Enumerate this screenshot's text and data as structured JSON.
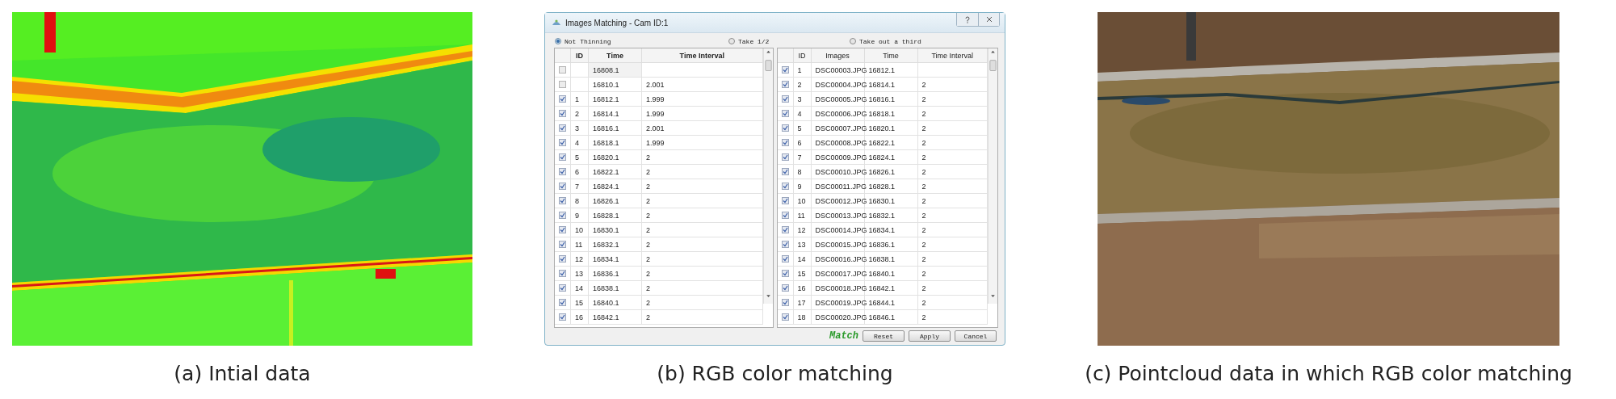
{
  "panels": [
    {
      "kind": "heatmap",
      "caption": "(a) Intial data"
    },
    {
      "kind": "dialog",
      "caption": "(b) RGB color matching"
    },
    {
      "kind": "aerial",
      "caption": "(c) Pointcloud data in which RGB color matching"
    }
  ],
  "dialog": {
    "title": "Images Matching - Cam ID:1",
    "options": [
      {
        "label": "Not Thinning",
        "selected": true
      },
      {
        "label": "Take 1/2",
        "selected": false
      },
      {
        "label": "Take out a third",
        "selected": false
      }
    ],
    "left_table": {
      "columns": [
        "ID",
        "Time",
        "Time Interval"
      ],
      "rows": [
        {
          "checked": false,
          "time": "16808.1"
        },
        {
          "checked": false,
          "time": "16810.1",
          "interval": "2.001"
        },
        {
          "checked": true,
          "id": "1",
          "time": "16812.1",
          "interval": "1.999"
        },
        {
          "checked": true,
          "id": "2",
          "time": "16814.1",
          "interval": "1.999"
        },
        {
          "checked": true,
          "id": "3",
          "time": "16816.1",
          "interval": "2.001"
        },
        {
          "checked": true,
          "id": "4",
          "time": "16818.1",
          "interval": "1.999"
        },
        {
          "checked": true,
          "id": "5",
          "time": "16820.1",
          "interval": "2"
        },
        {
          "checked": true,
          "id": "6",
          "time": "16822.1",
          "interval": "2"
        },
        {
          "checked": true,
          "id": "7",
          "time": "16824.1",
          "interval": "2"
        },
        {
          "checked": true,
          "id": "8",
          "time": "16826.1",
          "interval": "2"
        },
        {
          "checked": true,
          "id": "9",
          "time": "16828.1",
          "interval": "2"
        },
        {
          "checked": true,
          "id": "10",
          "time": "16830.1",
          "interval": "2"
        },
        {
          "checked": true,
          "id": "11",
          "time": "16832.1",
          "interval": "2"
        },
        {
          "checked": true,
          "id": "12",
          "time": "16834.1",
          "interval": "2"
        },
        {
          "checked": true,
          "id": "13",
          "time": "16836.1",
          "interval": "2"
        },
        {
          "checked": true,
          "id": "14",
          "time": "16838.1",
          "interval": "2"
        },
        {
          "checked": true,
          "id": "15",
          "time": "16840.1",
          "interval": "2"
        },
        {
          "checked": true,
          "id": "16",
          "time": "16842.1",
          "interval": "2"
        }
      ]
    },
    "right_table": {
      "columns": [
        "ID",
        "Images",
        "Time",
        "Time Interval"
      ],
      "rows": [
        {
          "checked": true,
          "id": "1",
          "image": "DSC00003.JPG",
          "time": "16812.1"
        },
        {
          "checked": true,
          "id": "2",
          "image": "DSC00004.JPG",
          "time": "16814.1",
          "interval": "2"
        },
        {
          "checked": true,
          "id": "3",
          "image": "DSC00005.JPG",
          "time": "16816.1",
          "interval": "2"
        },
        {
          "checked": true,
          "id": "4",
          "image": "DSC00006.JPG",
          "time": "16818.1",
          "interval": "2"
        },
        {
          "checked": true,
          "id": "5",
          "image": "DSC00007.JPG",
          "time": "16820.1",
          "interval": "2"
        },
        {
          "checked": true,
          "id": "6",
          "image": "DSC00008.JPG",
          "time": "16822.1",
          "interval": "2"
        },
        {
          "checked": true,
          "id": "7",
          "image": "DSC00009.JPG",
          "time": "16824.1",
          "interval": "2"
        },
        {
          "checked": true,
          "id": "8",
          "image": "DSC00010.JPG",
          "time": "16826.1",
          "interval": "2"
        },
        {
          "checked": true,
          "id": "9",
          "image": "DSC00011.JPG",
          "time": "16828.1",
          "interval": "2"
        },
        {
          "checked": true,
          "id": "10",
          "image": "DSC00012.JPG",
          "time": "16830.1",
          "interval": "2"
        },
        {
          "checked": true,
          "id": "11",
          "image": "DSC00013.JPG",
          "time": "16832.1",
          "interval": "2"
        },
        {
          "checked": true,
          "id": "12",
          "image": "DSC00014.JPG",
          "time": "16834.1",
          "interval": "2"
        },
        {
          "checked": true,
          "id": "13",
          "image": "DSC00015.JPG",
          "time": "16836.1",
          "interval": "2"
        },
        {
          "checked": true,
          "id": "14",
          "image": "DSC00016.JPG",
          "time": "16838.1",
          "interval": "2"
        },
        {
          "checked": true,
          "id": "15",
          "image": "DSC00017.JPG",
          "time": "16840.1",
          "interval": "2"
        },
        {
          "checked": true,
          "id": "16",
          "image": "DSC00018.JPG",
          "time": "16842.1",
          "interval": "2"
        },
        {
          "checked": true,
          "id": "17",
          "image": "DSC00019.JPG",
          "time": "16844.1",
          "interval": "2"
        },
        {
          "checked": true,
          "id": "18",
          "image": "DSC00020.JPG",
          "time": "16846.1",
          "interval": "2"
        }
      ]
    },
    "match_label": "Match",
    "buttons": [
      "Reset",
      "Apply",
      "Cancel"
    ]
  }
}
